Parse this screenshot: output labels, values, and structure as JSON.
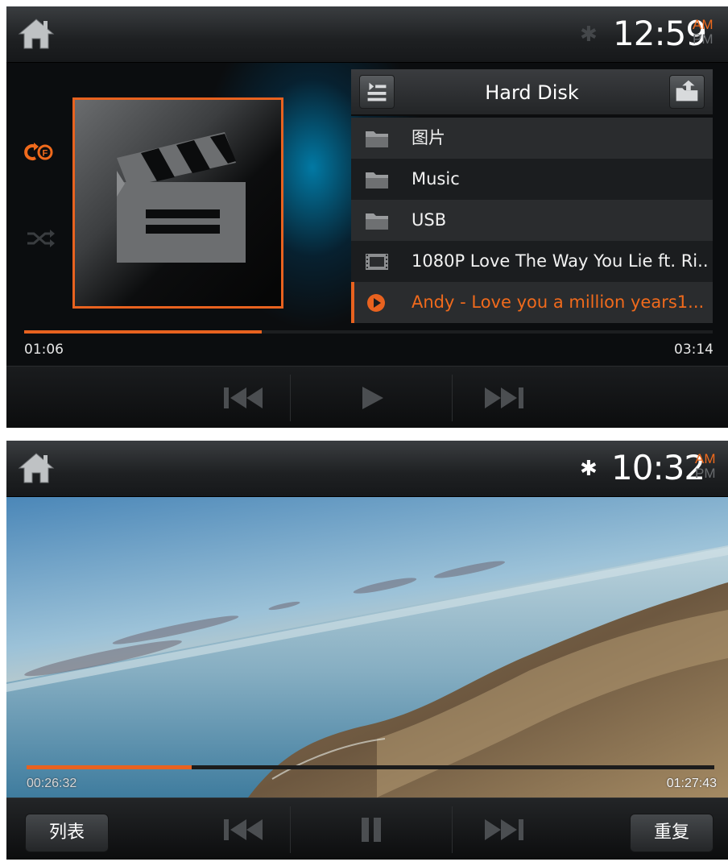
{
  "screen1": {
    "clock": {
      "time": "12:59",
      "am": "AM",
      "pm": "PM",
      "period": "AM"
    },
    "bluetooth": {
      "connected": false
    },
    "playback": {
      "repeat_mode": "repeat-folder",
      "shuffle": false
    },
    "file_list": {
      "title": "Hard Disk",
      "items": [
        {
          "type": "folder",
          "label": "图片"
        },
        {
          "type": "folder",
          "label": "Music"
        },
        {
          "type": "folder",
          "label": "USB"
        },
        {
          "type": "video",
          "label": "1080P Love The Way You Lie ft. Ri..."
        },
        {
          "type": "playing",
          "label": "Andy - Love you a million years1..."
        }
      ]
    },
    "progress": {
      "elapsed": "01:06",
      "total": "03:14",
      "fraction": 0.345
    },
    "controls": {
      "state": "paused"
    }
  },
  "screen2": {
    "clock": {
      "time": "10:32",
      "am": "AM",
      "pm": "PM",
      "period": "AM"
    },
    "bluetooth": {
      "connected": true
    },
    "progress": {
      "elapsed": "00:26:32",
      "total": "01:27:43",
      "fraction": 0.24
    },
    "controls": {
      "state": "playing",
      "list_label": "列表",
      "repeat_label": "重复"
    }
  },
  "colors": {
    "accent": "#e8621f",
    "background": "#0d0f11",
    "text": "#f2f2f2"
  }
}
